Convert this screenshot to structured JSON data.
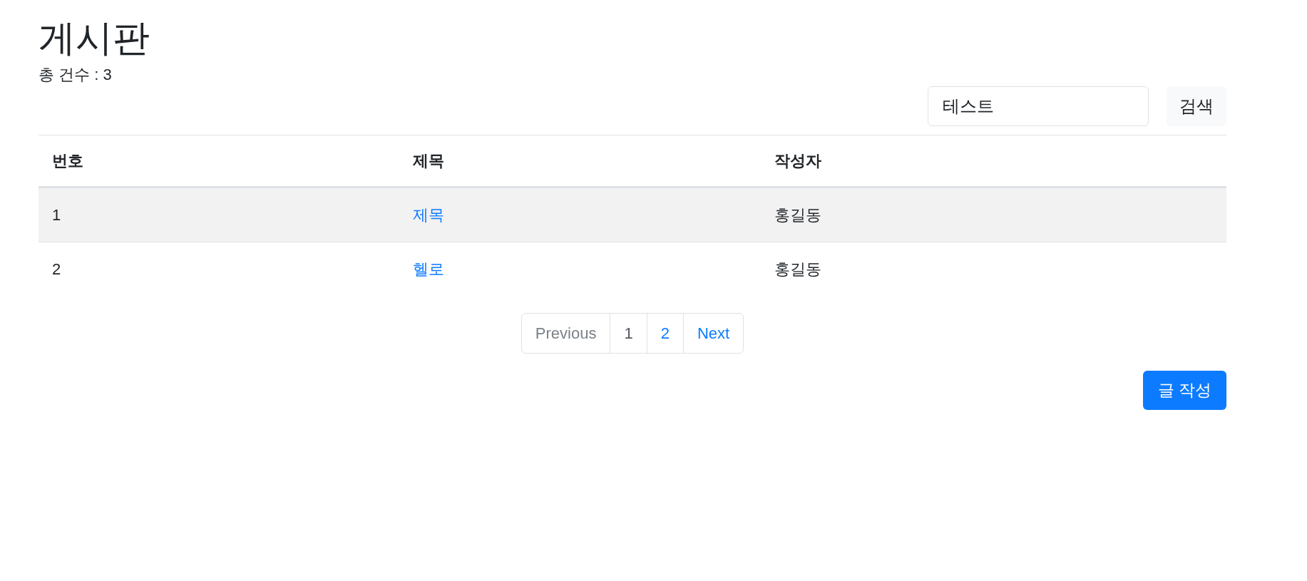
{
  "title": "게시판",
  "total_count": "총 건수 : 3",
  "search": {
    "value": "테스트",
    "button": "검색"
  },
  "table": {
    "columns": [
      "번호",
      "제목",
      "작성자"
    ],
    "rows": [
      {
        "number": "1",
        "title": "제목",
        "author": "홍길동",
        "hovered": true
      },
      {
        "number": "2",
        "title": "헬로",
        "author": "홍길동",
        "hovered": false
      }
    ]
  },
  "pagination": [
    {
      "label": "Previous",
      "disabled": true,
      "selected": false
    },
    {
      "label": "1",
      "disabled": false,
      "selected": true
    },
    {
      "label": "2",
      "disabled": false,
      "selected": false
    },
    {
      "label": "Next",
      "disabled": false,
      "selected": false
    }
  ],
  "write_button": "글 작성"
}
